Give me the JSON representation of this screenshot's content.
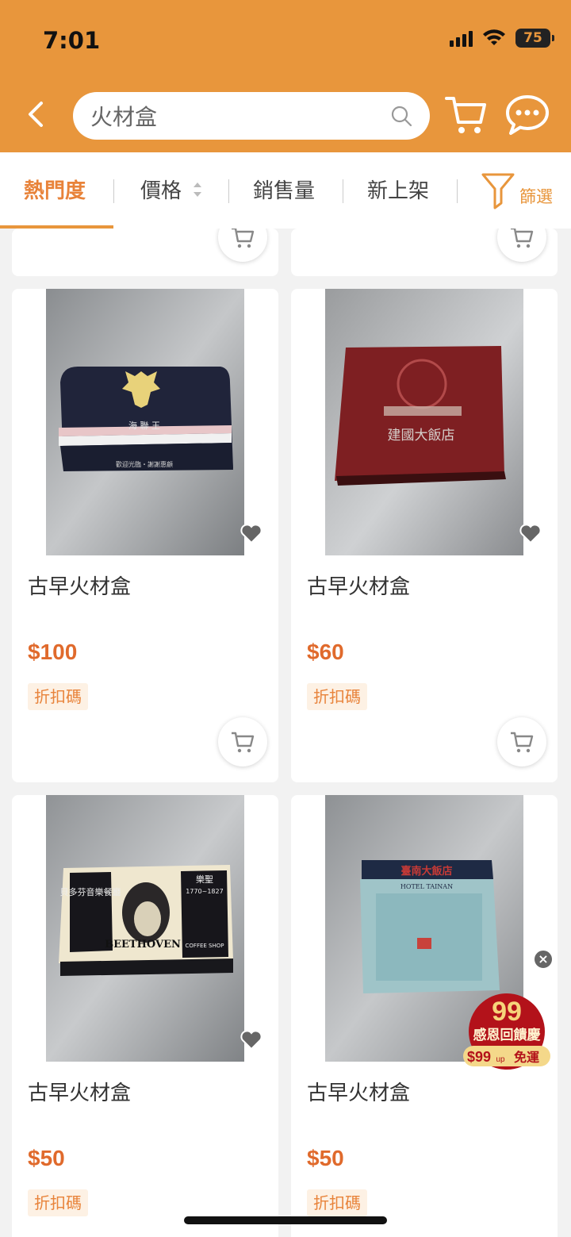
{
  "status": {
    "time": "7:01",
    "battery": "75"
  },
  "search": {
    "query": "火材盒"
  },
  "sort": {
    "popular": "熱門度",
    "price": "價格",
    "sales": "銷售量",
    "new": "新上架",
    "filter": "篩選"
  },
  "products": [
    {
      "title": "古早火材盒",
      "price": "$100",
      "coupon": "折扣碼",
      "image": "lobster-matchbox"
    },
    {
      "title": "古早火材盒",
      "price": "$60",
      "coupon": "折扣碼",
      "image": "hotel-matchbox"
    },
    {
      "title": "古早火材盒",
      "price": "$50",
      "coupon": "折扣碼",
      "image": "beethoven-matchbox"
    },
    {
      "title": "古早火材盒",
      "price": "$50",
      "coupon": "折扣碼",
      "image": "hotel-tainan-matchbox"
    }
  ],
  "image_text": {
    "lobster": "海 聯 王",
    "lobster_footer": "歡迎光臨・謝謝惠顧",
    "hotel": "建國大飯店",
    "beethoven_left": "貝多芬音樂餐廳",
    "beethoven_right": "樂聖",
    "beethoven_years": "1770~1827",
    "beethoven_name": "BEETHOVEN",
    "beethoven_shop": "COFFEE SHOP",
    "tainan_cn": "臺南大飯店",
    "tainan_en": "HOTEL TAINAN"
  },
  "promo": {
    "number": "99",
    "line1": "感恩回饋慶",
    "line2_price": "$99",
    "line2_up": "up",
    "line2_text": "免運"
  },
  "colors": {
    "brand": "#e8963c",
    "price": "#e06a2c"
  }
}
